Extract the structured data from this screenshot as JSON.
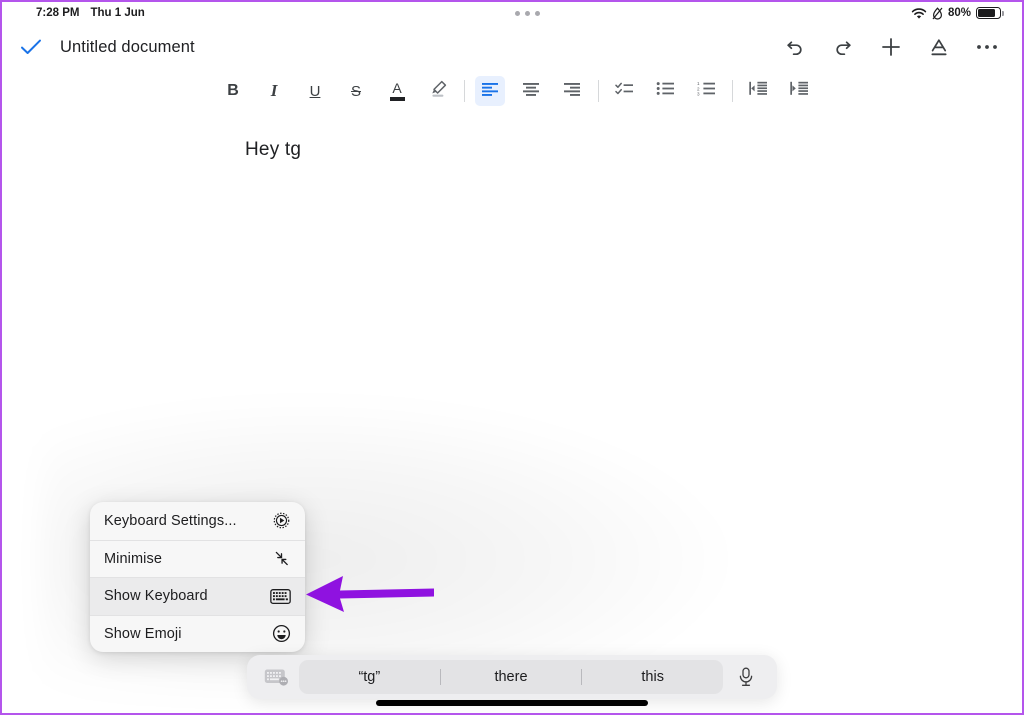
{
  "status_bar": {
    "time": "7:28 PM",
    "date": "Thu 1 Jun",
    "battery_percent": "80%",
    "wifi_icon": "wifi-icon",
    "dnd_icon": "do-not-disturb-icon",
    "battery_icon": "battery-icon",
    "multitask_icon": "multitasking-dots-icon"
  },
  "app_bar": {
    "doc_saved_icon": "checkmark-icon",
    "doc_saved_color": "#1a73e8",
    "title": "Untitled document",
    "actions": [
      {
        "name": "undo-button",
        "icon": "undo-icon"
      },
      {
        "name": "redo-button",
        "icon": "redo-icon"
      },
      {
        "name": "insert-button",
        "icon": "plus-icon"
      },
      {
        "name": "format-button",
        "icon": "format-text-icon"
      },
      {
        "name": "more-options-button",
        "icon": "ellipsis-icon"
      }
    ]
  },
  "format_toolbar": {
    "active_color": "#1a73e8",
    "active_bg": "#e8f0fe",
    "items": [
      {
        "name": "bold-button",
        "label": "B",
        "icon": "bold-icon"
      },
      {
        "name": "italic-button",
        "label": "I",
        "icon": "italic-icon"
      },
      {
        "name": "underline-button",
        "label": "U",
        "icon": "underline-icon"
      },
      {
        "name": "strikethrough-button",
        "label": "S",
        "icon": "strikethrough-icon"
      },
      {
        "name": "text-color-button",
        "label": "A",
        "icon": "text-color-icon"
      },
      {
        "name": "highlight-button",
        "label": "",
        "icon": "highlighter-icon"
      },
      {
        "name": "align-left-button",
        "label": "",
        "icon": "align-left-icon"
      },
      {
        "name": "align-center-button",
        "label": "",
        "icon": "align-center-icon"
      },
      {
        "name": "align-right-button",
        "label": "",
        "icon": "align-right-icon"
      },
      {
        "name": "checklist-button",
        "label": "",
        "icon": "checklist-icon"
      },
      {
        "name": "bulleted-list-button",
        "label": "",
        "icon": "bulleted-list-icon"
      },
      {
        "name": "numbered-list-button",
        "label": "",
        "icon": "numbered-list-icon"
      },
      {
        "name": "decrease-indent-button",
        "label": "",
        "icon": "decrease-indent-icon"
      },
      {
        "name": "increase-indent-button",
        "label": "",
        "icon": "increase-indent-icon"
      }
    ]
  },
  "document": {
    "body_text": "Hey tg"
  },
  "keyboard_menu": {
    "items": [
      {
        "label": "Keyboard Settings...",
        "icon": "gear-icon",
        "highlighted": false
      },
      {
        "label": "Minimise",
        "icon": "minimise-arrows-icon",
        "highlighted": false
      },
      {
        "label": "Show Keyboard",
        "icon": "keyboard-icon",
        "highlighted": true
      },
      {
        "label": "Show Emoji",
        "icon": "smiley-face-icon",
        "highlighted": false
      }
    ]
  },
  "annotation": {
    "arrow_icon": "left-pointing-arrow",
    "arrow_color": "#8f12e0"
  },
  "predictive_bar": {
    "keyboard_icon": "keyboard-switch-icon",
    "mic_icon": "microphone-icon",
    "suggestions": [
      "“tg”",
      "there",
      "this"
    ]
  },
  "frame": {
    "border_color": "#b455ec",
    "home_indicator": "home-indicator"
  }
}
